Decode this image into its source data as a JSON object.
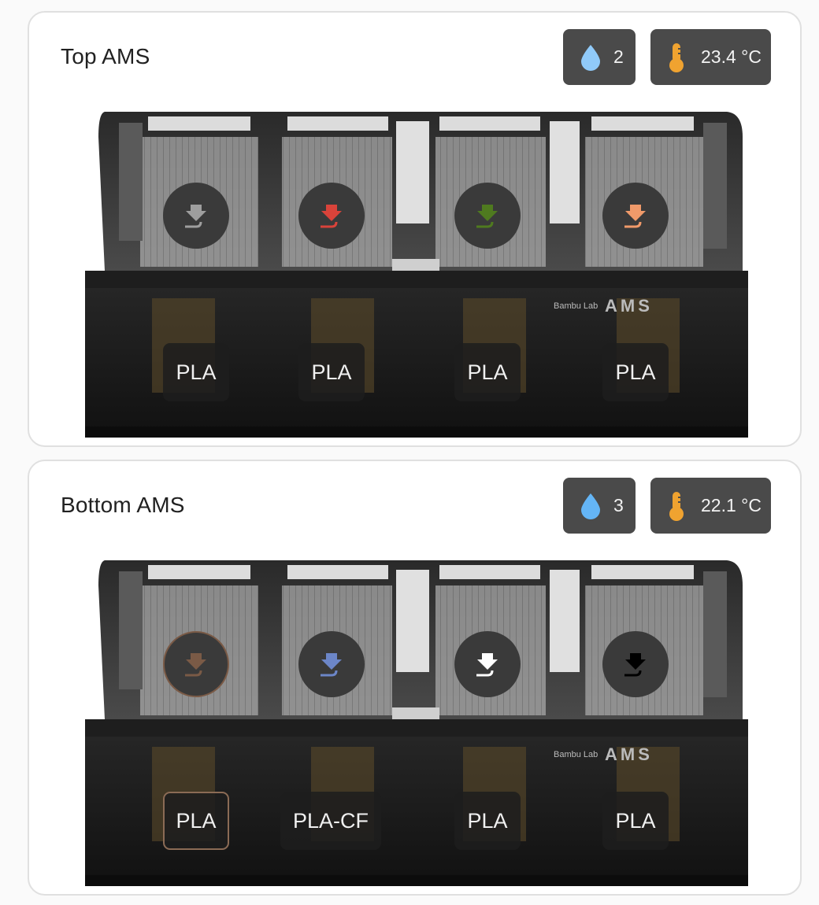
{
  "units": [
    {
      "title": "Top AMS",
      "humidity": {
        "icon": "water-drop-icon",
        "color": "#90caf9",
        "value": "2"
      },
      "temperature": {
        "icon": "thermometer-icon",
        "color": "#f0a330",
        "value": "23.4 °C"
      },
      "slots": [
        {
          "color": "#9e9e9e",
          "material": "PLA",
          "active": false
        },
        {
          "color": "#d9433a",
          "material": "PLA",
          "active": false
        },
        {
          "color": "#4f7a1f",
          "material": "PLA",
          "active": false
        },
        {
          "color": "#f09a6a",
          "material": "PLA",
          "active": false
        }
      ]
    },
    {
      "title": "Bottom AMS",
      "humidity": {
        "icon": "water-drop-icon",
        "color": "#64b5f6",
        "value": "3"
      },
      "temperature": {
        "icon": "thermometer-icon",
        "color": "#f0a330",
        "value": "22.1 °C"
      },
      "slots": [
        {
          "color": "#7a5a46",
          "material": "PLA",
          "active": true
        },
        {
          "color": "#6c86c8",
          "material": "PLA-CF",
          "active": false
        },
        {
          "color": "#ffffff",
          "material": "PLA",
          "active": false
        },
        {
          "color": "#000000",
          "material": "PLA",
          "active": false
        }
      ]
    }
  ]
}
